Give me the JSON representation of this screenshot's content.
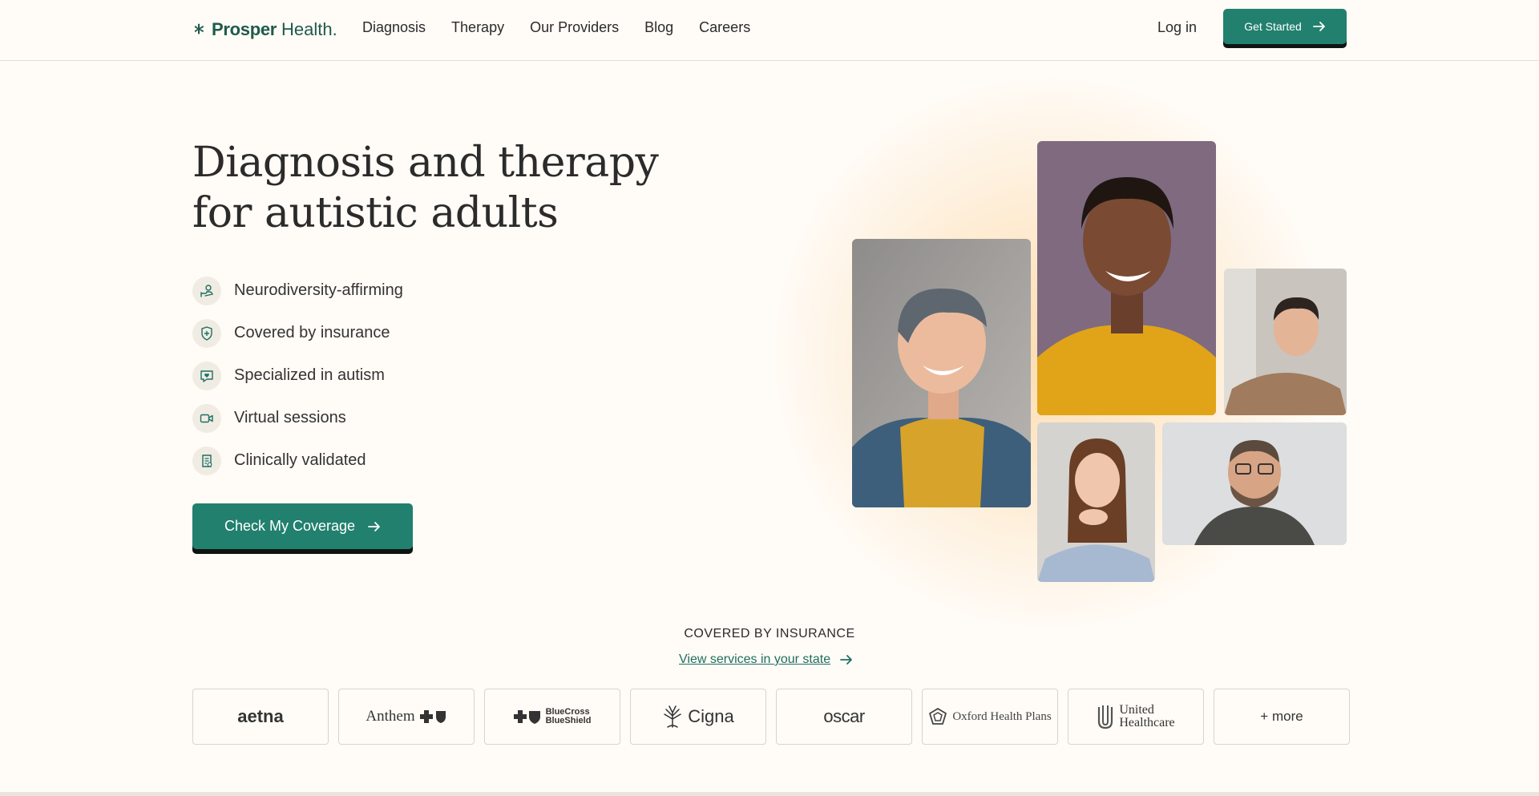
{
  "header": {
    "logo_name": "Prosper",
    "logo_suffix": "Health.",
    "nav": [
      "Diagnosis",
      "Therapy",
      "Our Providers",
      "Blog",
      "Careers"
    ],
    "login_label": "Log in",
    "cta_label": "Get Started"
  },
  "hero": {
    "title_line1": "Diagnosis and therapy",
    "title_line2": "for autistic adults",
    "features": [
      {
        "label": "Neurodiversity-affirming",
        "icon": "hand-heart-icon"
      },
      {
        "label": "Covered by insurance",
        "icon": "shield-plus-icon"
      },
      {
        "label": "Specialized in autism",
        "icon": "chat-heart-icon"
      },
      {
        "label": "Virtual sessions",
        "icon": "video-camera-icon"
      },
      {
        "label": "Clinically validated",
        "icon": "clipboard-check-icon"
      }
    ],
    "cta_label": "Check My Coverage"
  },
  "insurance": {
    "heading": "COVERED BY INSURANCE",
    "link_label": "View services in your state",
    "providers": [
      "aetna",
      "Anthem",
      "BlueCross BlueShield",
      "Cigna",
      "oscar",
      "Oxford Health Plans",
      "United Healthcare"
    ],
    "bcbs_line1": "BlueCross",
    "bcbs_line2": "BlueShield",
    "uhc_line1": "United",
    "uhc_line2": "Healthcare",
    "more_label": "+ more"
  },
  "colors": {
    "brand_green": "#22806e",
    "background": "#fffbf6",
    "text": "#2b2b2b"
  }
}
